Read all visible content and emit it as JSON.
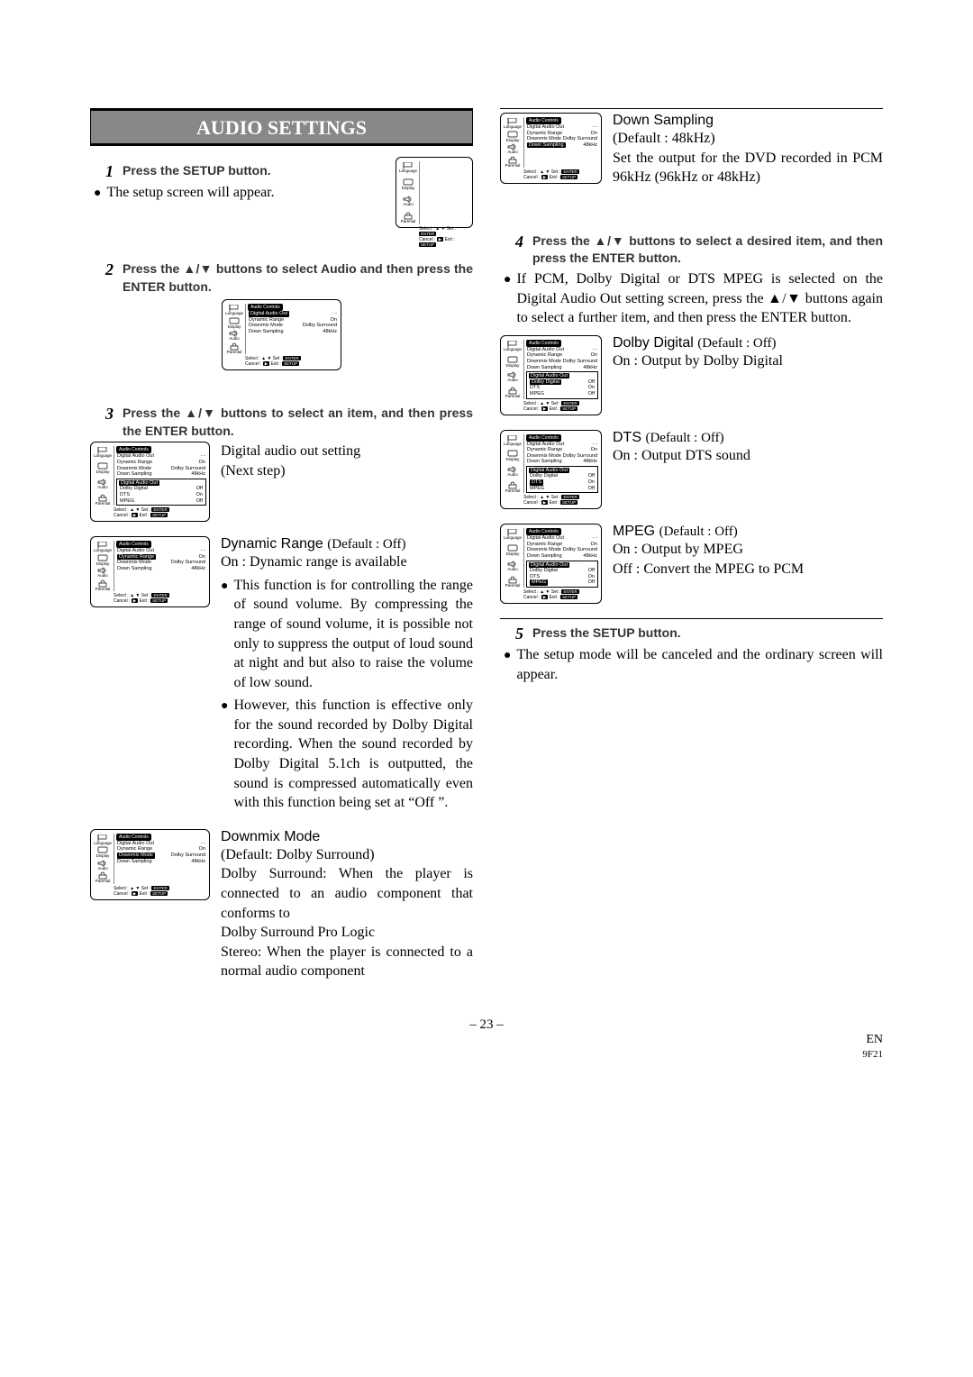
{
  "title": "AUDIO SETTINGS",
  "steps": {
    "s1": {
      "num": "1",
      "text": "Press the SETUP button."
    },
    "s2": {
      "num": "2",
      "text": "Press the ▲/▼ buttons to select Audio and then press the ENTER button."
    },
    "s3": {
      "num": "3",
      "text": "Press the ▲/▼ buttons to select an item, and then press the ENTER button."
    },
    "s4": {
      "num": "4",
      "text": "Press the ▲/▼ buttons to select a desired item, and then press the ENTER button."
    },
    "s5": {
      "num": "5",
      "text": "Press the SETUP button."
    }
  },
  "bullets": {
    "b1": "The setup screen will appear.",
    "b4": "If PCM, Dolby Digital or DTS MPEG is selected on the Digital Audio Out setting screen, press the ▲/▼ buttons again to select a further item, and then press the ENTER button.",
    "b5": "The setup mode will be canceled and the ordinary screen will appear."
  },
  "digital_audio_out": {
    "label": "Digital audio out setting",
    "next": "(Next step)"
  },
  "dynamic_range": {
    "title": "Dynamic Range",
    "default": "(Default : Off)",
    "on_line": "On : Dynamic range is available",
    "p1": "This function is for controlling the range of sound volume. By compressing the range of sound volume, it is possible not only to suppress the output of loud sound at night and but also to raise the volume of low sound.",
    "p2": "However, this function is effective only for the sound recorded by Dolby Digital recording. When the sound recorded by Dolby Digital 5.1ch is outputted, the sound is compressed automatically even with this function being set at “Off ”."
  },
  "downmix": {
    "title": "Downmix Mode",
    "default": "(Default: Dolby Surround)",
    "p1": "Dolby Surround: When the player is connected to an audio component that conforms to",
    "p2": "Dolby Surround Pro Logic",
    "p3": "Stereo: When the player is connected to a normal audio component"
  },
  "down_sampling": {
    "title": "Down Sampling",
    "default": "(Default : 48kHz)",
    "p": "Set the output for the DVD recorded in PCM 96kHz (96kHz or 48kHz)"
  },
  "dolby": {
    "title": "Dolby Digital",
    "default": "(Default : Off)",
    "on": "On : Output by Dolby Digital"
  },
  "dts": {
    "title": "DTS",
    "default": "(Default : Off)",
    "on": "On : Output DTS sound"
  },
  "mpeg": {
    "title": "MPEG",
    "default": "(Default : Off)",
    "on": "On : Output by MPEG",
    "off": "Off : Convert the MPEG to PCM"
  },
  "osd": {
    "sidebar": {
      "lang": "Language",
      "display": "Display",
      "audio": "Audio",
      "parental": "Parental"
    },
    "title": "Audio Controls",
    "row_dao": "Digital Audio Out",
    "row_dr": "Dynamic Range",
    "row_dm": "Downmix Mode",
    "row_ds": "Down Sampling",
    "val_dash": "- -",
    "val_on": "On",
    "val_off": "Off",
    "val_dolby": "Dolby Surround",
    "val_48": "48kHz",
    "sub_dolby": "Dolby Digital",
    "sub_dts": "DTS",
    "sub_mpeg": "MPEG",
    "footer_select": "Select :",
    "footer_set": "Set :",
    "footer_cancel": "Cancel :",
    "footer_exit": "Exit :",
    "key_enter": "ENTER",
    "key_setup": "SETUP",
    "key_play": "▶"
  },
  "page": {
    "num": "– 23 –",
    "lang": "EN",
    "code": "9F21"
  }
}
